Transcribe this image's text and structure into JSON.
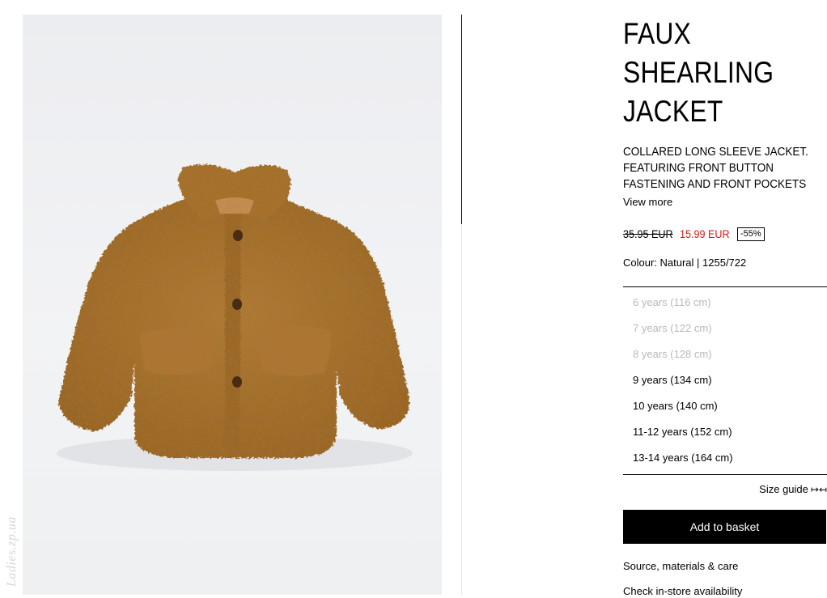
{
  "product": {
    "title_line1": "FAUX",
    "title_line2": "SHEARLING",
    "title_line3": "JACKET",
    "description_line1": "COLLARED LONG SLEEVE JACKET.",
    "description_line2": "FEATURING FRONT BUTTON",
    "description_line3": "FASTENING AND FRONT POCKETS",
    "view_more": "View more",
    "price_old": "35.95 EUR",
    "price_new": "15.99 EUR",
    "discount": "-55%",
    "colour": "Colour: Natural | 1255/722"
  },
  "sizes": [
    {
      "label": "6 years (116 cm)",
      "available": false
    },
    {
      "label": "7 years (122 cm)",
      "available": false
    },
    {
      "label": "8 years (128 cm)",
      "available": false
    },
    {
      "label": "9 years (134 cm)",
      "available": true
    },
    {
      "label": "10 years (140 cm)",
      "available": true
    },
    {
      "label": "11-12 years (152 cm)",
      "available": true
    },
    {
      "label": "13-14 years (164 cm)",
      "available": true
    }
  ],
  "actions": {
    "size_guide": "Size guide",
    "size_guide_icon": "width-arrows-icon",
    "add_to_basket": "Add to basket",
    "source_materials": "Source, materials & care",
    "check_store": "Check in-store availability"
  },
  "image": {
    "watermark": "Ladies.zp.ua",
    "jacket_color": "#a8712c",
    "background_color": "#eeeff1"
  },
  "colors": {
    "sale_price": "#d31a1a",
    "unavailable_size": "#b9b9b9",
    "button_bg": "#000000"
  }
}
